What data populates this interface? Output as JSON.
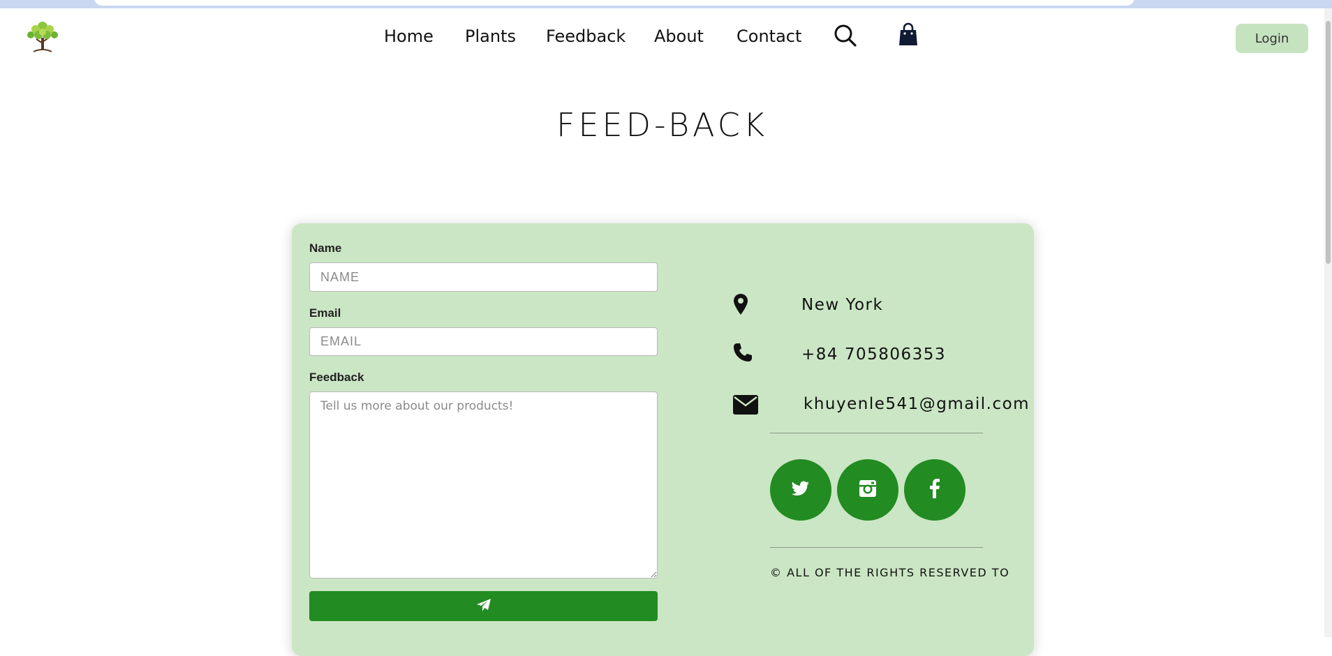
{
  "nav": {
    "items": [
      "Home",
      "Plants",
      "Feedback",
      "About",
      "Contact"
    ],
    "search_icon": "search-icon",
    "cart_icon": "shopping-bag-icon",
    "login_label": "Login"
  },
  "page": {
    "title": "FEED-BACK"
  },
  "form": {
    "name_label": "Name",
    "name_placeholder": "NAME",
    "email_label": "Email",
    "email_placeholder": "EMAIL",
    "feedback_label": "Feedback",
    "feedback_placeholder": "Tell us more about our products!",
    "send_icon": "paper-plane-icon"
  },
  "contact": {
    "location": "New York",
    "phone": "+84 705806353",
    "email": "khuyenle541@gmail.com"
  },
  "social": [
    "twitter-icon",
    "instagram-icon",
    "facebook-icon"
  ],
  "footer": {
    "copyright": "© ALL OF THE RIGHTS RESERVED TO"
  },
  "colors": {
    "accent_green": "#228b22",
    "card_bg": "#cbe6c4",
    "login_bg": "#c6e3c0"
  }
}
